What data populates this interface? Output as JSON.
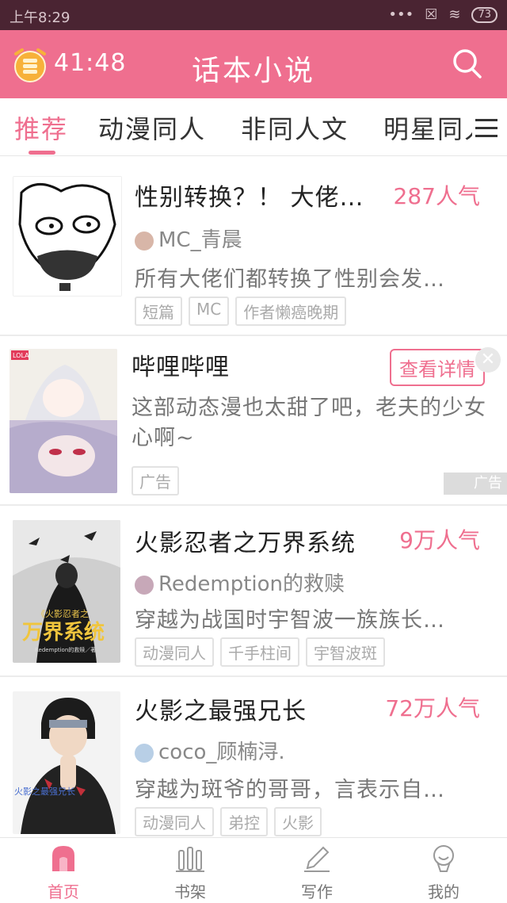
{
  "status": {
    "time": "上午8:29",
    "battery": "73"
  },
  "header": {
    "timer": "41:48",
    "title": "话本小说"
  },
  "tabs": [
    "推荐",
    "动漫同人",
    "非同人文",
    "明星同人"
  ],
  "books": [
    {
      "title": "性别转换？！ 大佬…",
      "popularity": "287人气",
      "author": "MC_青晨",
      "desc": "所有大佬们都转换了性别会发…",
      "tags": [
        "短篇",
        "MC",
        "作者懒癌晚期"
      ]
    },
    {
      "title": "火影忍者之万界系统",
      "popularity": "9万人气",
      "author": "Redemption的救赎",
      "desc": "穿越为战国时宇智波一族族长…",
      "tags": [
        "动漫同人",
        "千手柱间",
        "宇智波斑"
      ]
    },
    {
      "title": "火影之最强兄长",
      "popularity": "72万人气",
      "author": "coco_顾楠浔.",
      "desc": "穿越为斑爷的哥哥，言表示自…",
      "tags": [
        "动漫同人",
        "弟控",
        "火影"
      ]
    }
  ],
  "ad": {
    "title": "哔哩哔哩",
    "button": "查看详情",
    "desc": "这部动态漫也太甜了吧，老夫的少女心啊~",
    "tag": "广告",
    "corner": "广告",
    "cover_badge": "LOLA"
  },
  "cover_texts": {
    "book2_top": "《火影忍者之",
    "book2_main": "万界系统",
    "book2_author": "Redemption的救赎／著",
    "book3_text": "火影之最强兄长"
  },
  "nav": [
    "首页",
    "书架",
    "写作",
    "我的"
  ],
  "colors": {
    "accent": "#ef6f8f",
    "statusbar": "#4a2432"
  }
}
